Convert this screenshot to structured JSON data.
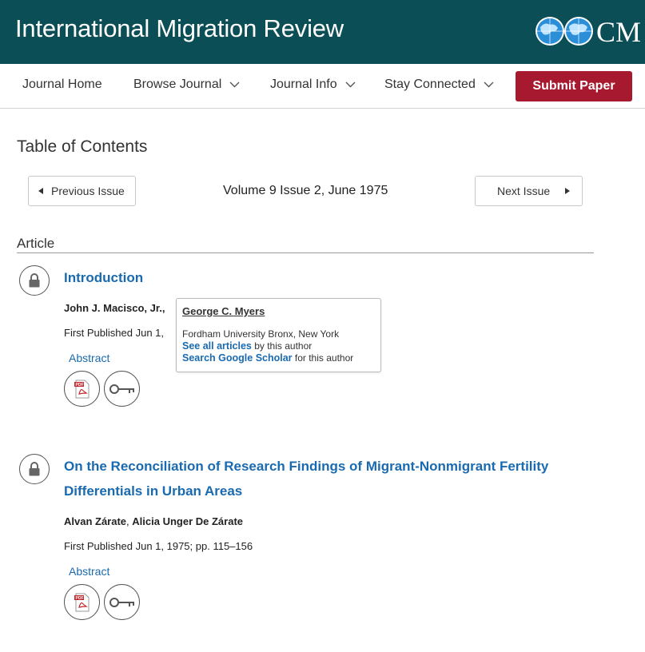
{
  "header": {
    "title": "International Migration Review",
    "logo_text": "CM"
  },
  "nav": {
    "items": [
      "Journal Home",
      "Browse Journal",
      "Journal Info",
      "Stay Connected"
    ],
    "submit": "Submit Paper"
  },
  "toc": {
    "title": "Table of Contents",
    "prev": "Previous Issue",
    "next": "Next Issue",
    "issue": "Volume 9 Issue 2, June 1975"
  },
  "section": "Article",
  "articles": [
    {
      "title": "Introduction",
      "authors": "John J. Macisco, Jr.,",
      "published": "First Published Jun 1,",
      "abstract": "Abstract"
    },
    {
      "title_line1": "On the Reconciliation of Research Findings of Migrant-Nonmigrant Fertility",
      "title_line2": "Differentials in Urban Areas",
      "author1": "Alvan Zárate",
      "sep": ", ",
      "author2": "Alicia Unger De Zárate",
      "published": "First Published Jun 1, 1975; pp. 115–156",
      "abstract": "Abstract"
    }
  ],
  "popup": {
    "name": "George C. Myers",
    "affiliation": "Fordham University Bronx, New York",
    "see_all": "See all articles",
    "see_all_suffix": " by this author",
    "scholar": "Search Google Scholar",
    "scholar_suffix": " for this author"
  },
  "colors": {
    "header_bg": "#0b4e56",
    "submit_bg": "#a6192e",
    "link": "#1a6ab0"
  },
  "icons": [
    "globe-icon",
    "chevron-down-icon",
    "lock-icon",
    "pdf-icon",
    "key-icon",
    "triangle-left-icon",
    "triangle-right-icon"
  ]
}
